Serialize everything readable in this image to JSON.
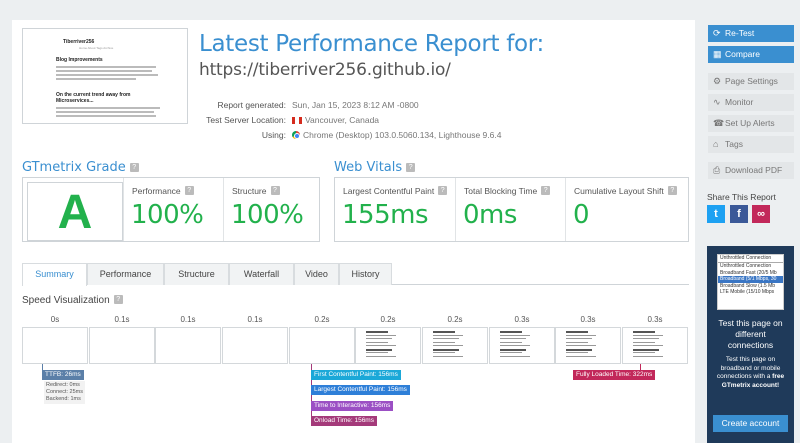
{
  "report": {
    "title": "Latest Performance Report for:",
    "url": "https://tiberriver256.github.io/",
    "meta": [
      {
        "label": "Report generated:",
        "value": "Sun, Jan 15, 2023 8:12 AM -0800",
        "icon": ""
      },
      {
        "label": "Test Server Location:",
        "value": "Vancouver, Canada",
        "icon": "canada-flag-icon"
      },
      {
        "label": "Using:",
        "value": "Chrome (Desktop) 103.0.5060.134, Lighthouse 9.6.4",
        "icon": "chrome-icon"
      }
    ]
  },
  "thumbnail": {
    "logo": "Tiberriver256",
    "nav": "Home  About  Tags  Archive",
    "heading1": "Blog Improvements",
    "heading2": "On the current trend away from Microservices..."
  },
  "gtmetrix": {
    "section_title": "GTmetrix Grade",
    "help": "?",
    "grade": "A",
    "grade_color": "#22b14c",
    "metrics": [
      {
        "label": "Performance",
        "value": "100%"
      },
      {
        "label": "Structure",
        "value": "100%"
      }
    ]
  },
  "vitals": {
    "section_title": "Web Vitals",
    "help": "?",
    "metrics": [
      {
        "label": "Largest Contentful Paint",
        "value": "155ms"
      },
      {
        "label": "Total Blocking Time",
        "value": "0ms"
      },
      {
        "label": "Cumulative Layout Shift",
        "value": "0"
      }
    ]
  },
  "tabs": [
    "Summary",
    "Performance",
    "Structure",
    "Waterfall",
    "Video",
    "History"
  ],
  "speed": {
    "title": "Speed Visualization",
    "help": "?",
    "frames": [
      {
        "time": "0s",
        "content": false
      },
      {
        "time": "0.1s",
        "content": false
      },
      {
        "time": "0.1s",
        "content": false
      },
      {
        "time": "0.1s",
        "content": false
      },
      {
        "time": "0.2s",
        "content": false
      },
      {
        "time": "0.2s",
        "content": true
      },
      {
        "time": "0.2s",
        "content": true
      },
      {
        "time": "0.3s",
        "content": true
      },
      {
        "time": "0.3s",
        "content": true
      },
      {
        "time": "0.3s",
        "content": true
      }
    ],
    "markers": [
      {
        "label": "TTFB: 26ms",
        "color": "#5b7fa8"
      },
      {
        "label": "First Contentful Paint: 156ms",
        "color": "#1ba8d8"
      },
      {
        "label": "Largest Contentful Paint: 156ms",
        "color": "#2e7fd8"
      },
      {
        "label": "Time to Interactive: 156ms",
        "color": "#9b4fc4"
      },
      {
        "label": "Onload Time: 156ms",
        "color": "#a43a7a"
      },
      {
        "label": "Fully Loaded Time: 322ms",
        "color": "#c2285a"
      }
    ],
    "ttfb_details": [
      "Redirect: 0ms",
      "Connect: 25ms",
      "Backend: 1ms"
    ]
  },
  "sidebar": {
    "buttons": [
      {
        "label": "Re-Test",
        "icon": "refresh-icon",
        "style": "blue"
      },
      {
        "label": "Compare",
        "icon": "compare-icon",
        "style": "blue"
      },
      {
        "label": "Page Settings",
        "icon": "gear-icon",
        "style": "grey"
      },
      {
        "label": "Monitor",
        "icon": "pulse-icon",
        "style": "grey"
      },
      {
        "label": "Set Up Alerts",
        "icon": "alerts-icon",
        "style": "grey"
      },
      {
        "label": "Tags",
        "icon": "tag-icon",
        "style": "grey"
      },
      {
        "label": "Download PDF",
        "icon": "pdf-icon",
        "style": "grey"
      }
    ],
    "share_title": "Share This Report",
    "share": [
      {
        "name": "twitter-icon",
        "glyph": "t",
        "color": "#1da1f2"
      },
      {
        "name": "facebook-icon",
        "glyph": "f",
        "color": "#3b5998"
      },
      {
        "name": "link-icon",
        "glyph": "∞",
        "color": "#c2285a"
      }
    ],
    "promo": {
      "options": [
        "Unthrottled Connection",
        "Unthrottled Connection",
        "Broadband Fast (20/5 Mb",
        "Broadband (5/1 Mbps, 30",
        "Broadband Slow (1.5 Mb",
        "LTE Mobile (15/10 Mbps"
      ],
      "selected_index": 3,
      "title": "Test this page on different connections",
      "text_before": "Test this page on broadband or mobile connections with a",
      "text_bold": "free GTmetrix account!",
      "button": "Create account"
    }
  }
}
